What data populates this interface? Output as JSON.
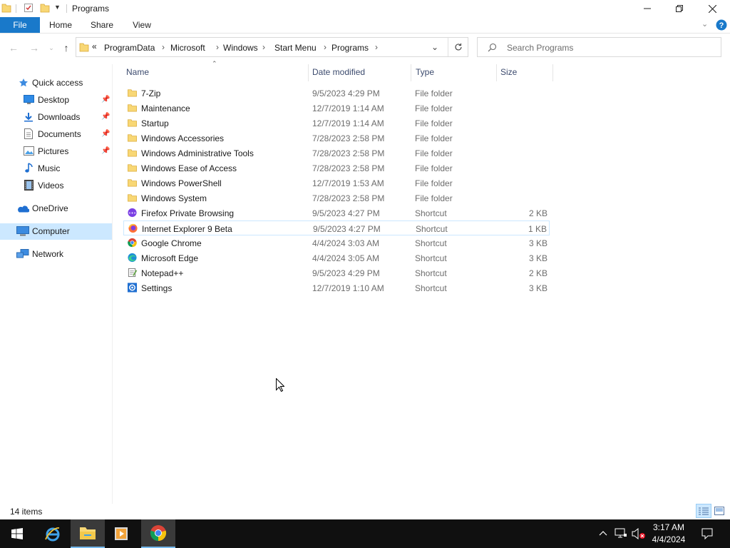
{
  "window": {
    "title": "Programs",
    "controls": [
      "minimize-icon",
      "restore-icon",
      "close-icon"
    ]
  },
  "ribbon": {
    "tabs": [
      "File",
      "Home",
      "Share",
      "View"
    ]
  },
  "address": {
    "overflow": "«",
    "crumbs": [
      "ProgramData",
      "Microsoft",
      "Windows",
      "Start Menu",
      "Programs"
    ]
  },
  "search": {
    "placeholder": "Search Programs"
  },
  "sidebar": {
    "quick_access": "Quick access",
    "quick_items": [
      "Desktop",
      "Downloads",
      "Documents",
      "Pictures",
      "Music",
      "Videos"
    ],
    "onedrive": "OneDrive",
    "computer": "Computer",
    "network": "Network"
  },
  "columns": {
    "name": "Name",
    "date": "Date modified",
    "type": "Type",
    "size": "Size"
  },
  "files": [
    {
      "name": "7-Zip",
      "date": "9/5/2023 4:29 PM",
      "type": "File folder",
      "size": "",
      "icon": "folder-icon"
    },
    {
      "name": "Maintenance",
      "date": "12/7/2019 1:14 AM",
      "type": "File folder",
      "size": "",
      "icon": "folder-icon"
    },
    {
      "name": "Startup",
      "date": "12/7/2019 1:14 AM",
      "type": "File folder",
      "size": "",
      "icon": "folder-icon"
    },
    {
      "name": "Windows Accessories",
      "date": "7/28/2023 2:58 PM",
      "type": "File folder",
      "size": "",
      "icon": "folder-icon"
    },
    {
      "name": "Windows Administrative Tools",
      "date": "7/28/2023 2:58 PM",
      "type": "File folder",
      "size": "",
      "icon": "folder-icon"
    },
    {
      "name": "Windows Ease of Access",
      "date": "7/28/2023 2:58 PM",
      "type": "File folder",
      "size": "",
      "icon": "folder-icon"
    },
    {
      "name": "Windows PowerShell",
      "date": "12/7/2019 1:53 AM",
      "type": "File folder",
      "size": "",
      "icon": "folder-icon"
    },
    {
      "name": "Windows System",
      "date": "7/28/2023 2:58 PM",
      "type": "File folder",
      "size": "",
      "icon": "folder-icon"
    },
    {
      "name": "Firefox Private Browsing",
      "date": "9/5/2023 4:27 PM",
      "type": "Shortcut",
      "size": "2 KB",
      "icon": "firefox-private-icon"
    },
    {
      "name": "Internet Explorer 9 Beta",
      "date": "9/5/2023 4:27 PM",
      "type": "Shortcut",
      "size": "1 KB",
      "icon": "firefox-icon"
    },
    {
      "name": "Google Chrome",
      "date": "4/4/2024 3:03 AM",
      "type": "Shortcut",
      "size": "3 KB",
      "icon": "chrome-icon"
    },
    {
      "name": "Microsoft Edge",
      "date": "4/4/2024 3:05 AM",
      "type": "Shortcut",
      "size": "3 KB",
      "icon": "edge-icon"
    },
    {
      "name": "Notepad++",
      "date": "9/5/2023 4:29 PM",
      "type": "Shortcut",
      "size": "2 KB",
      "icon": "notepadpp-icon"
    },
    {
      "name": "Settings",
      "date": "12/7/2019 1:10 AM",
      "type": "Shortcut",
      "size": "3 KB",
      "icon": "settings-icon"
    }
  ],
  "status": {
    "item_count": "14 items"
  },
  "taskbar": {
    "apps": [
      "start-icon",
      "internet-explorer-icon",
      "file-explorer-icon",
      "media-player-icon",
      "chrome-icon"
    ],
    "time": "3:17 AM",
    "date": "4/4/2024"
  },
  "colors": {
    "accent": "#1979ca",
    "selection": "#cce8ff",
    "folder": "#f8d775",
    "taskbar": "#101010"
  }
}
